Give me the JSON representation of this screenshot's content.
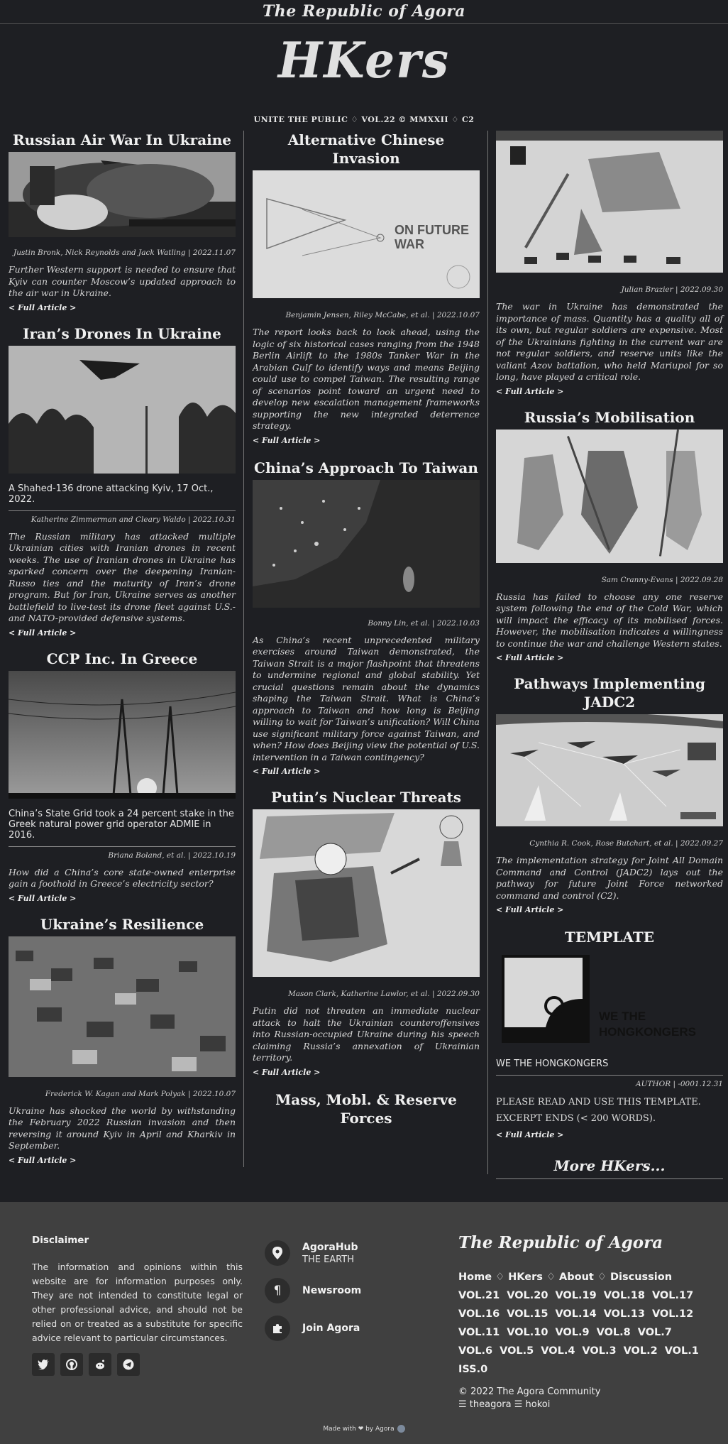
{
  "header": {
    "site_title": "The Republic of Agora",
    "logo": "HKers",
    "subline": "UNITE THE PUBLIC ♢ VOL.22 © MMXXII ♢ C2"
  },
  "articles": {
    "air_war": {
      "title": "Russian Air War In Ukraine",
      "byline": "Justin Bronk, Nick Reynolds and Jack Watling | 2022.11.07",
      "excerpt": "Further Western support is needed to ensure that Kyiv can counter Moscow’s updated approach to the air war in Ukraine.",
      "full": "< Full Article >"
    },
    "drones": {
      "title": "Iran’s Drones In Ukraine",
      "caption": "A Shahed-136 drone attacking Kyiv, 17 Oct., 2022.",
      "byline": "Katherine Zimmerman and Cleary Waldo | 2022.10.31",
      "excerpt": "The Russian military has attacked multiple Ukrainian cities with Iranian drones in recent weeks. The use of Iranian drones in Ukraine has sparked concern over the deepening Iranian-Russo ties and the maturity of Iran’s drone program. But for Iran, Ukraine serves as another battlefield to live-test its drone fleet against U.S.- and NATO-provided defensive systems.",
      "full": "< Full Article >"
    },
    "greece": {
      "title": "CCP Inc. In Greece",
      "caption": "China’s State Grid took a 24 percent stake in the Greek natural power grid operator ADMIE in 2016.",
      "byline": "Briana Boland, et al. | 2022.10.19",
      "excerpt": "How did a China’s core state-owned enterprise gain a foothold in Greece’s electricity sector?",
      "full": "< Full Article >"
    },
    "resilience": {
      "title": "Ukraine’s Resilience",
      "byline": "Frederick W. Kagan and Mark Polyak | 2022.10.07",
      "excerpt": "Ukraine has shocked the world by withstanding the February 2022 Russian invasion and then reversing it around Kyiv in April and Kharkiv in September.",
      "full": "< Full Article >"
    },
    "chinese_invasion": {
      "title": "Alternative Chinese Invasion",
      "image_text_1": "ON FUTURE",
      "image_text_2": "WAR",
      "byline": "Benjamin Jensen, Riley McCabe, et al. | 2022.10.07",
      "excerpt": "The report looks back to look ahead, using the logic of six historical cases ranging from the 1948 Berlin Airlift to the 1980s Tanker War in the Arabian Gulf to identify ways and means Beijing could use to compel Taiwan. The resulting range of scenarios point toward an urgent need to develop new escalation management frameworks supporting the new integrated deterrence strategy.",
      "full": "< Full Article >"
    },
    "taiwan": {
      "title": "China’s Approach To Taiwan",
      "byline": "Bonny Lin, et al. | 2022.10.03",
      "excerpt": "As China’s recent unprecedented military exercises around Taiwan demonstrated, the Taiwan Strait is a major flashpoint that threatens to undermine regional and global stability. Yet crucial questions remain about the dynamics shaping the Taiwan Strait. What is China’s approach to Taiwan and how long is Beijing willing to wait for Taiwan’s unification? Will China use significant military force against Taiwan, and when? How does Beijing view the potential of U.S. intervention in a Taiwan contingency?",
      "full": "< Full Article >"
    },
    "nuclear": {
      "title": "Putin’s Nuclear Threats",
      "byline": "Mason Clark, Katherine Lawlor, et al. | 2022.09.30",
      "excerpt": "Putin did not threaten an immediate nuclear attack to halt the Ukrainian counteroffensives into Russian-occupied Ukraine during his speech claiming Russia’s annexation of Ukrainian territory.",
      "full": "< Full Article >"
    },
    "mass": {
      "title": "Mass, Mobl. & Reserve Forces"
    },
    "mass_body": {
      "byline": "Julian Brazier | 2022.09.30",
      "excerpt": "The war in Ukraine has demonstrated the importance of mass. Quantity has a quality all of its own, but regular soldiers are expensive. Most of the Ukrainians fighting in the current war are not regular soldiers, and reserve units like the valiant Azov battalion, who held Mariupol for so long, have played a critical role.",
      "full": "< Full Article >"
    },
    "mobilisation": {
      "title": "Russia’s Mobilisation",
      "byline": "Sam Cranny-Evans | 2022.09.28",
      "excerpt": "Russia has failed to choose any one reserve system following the end of the Cold War, which will impact the efficacy of its mobilised forces. However, the mobilisation indicates a willingness to continue the war and challenge Western states.",
      "full": "< Full Article >"
    },
    "jadc2": {
      "title": "Pathways Implementing JADC2",
      "byline": "Cynthia R. Cook, Rose Butchart, et al. | 2022.09.27",
      "excerpt": "The implementation strategy for Joint All Domain Command and Control (JADC2) lays out the pathway for future Joint Force networked command and control (C2).",
      "full": "< Full Article >"
    },
    "template": {
      "title": "TEMPLATE",
      "image_text_1": "WE THE",
      "image_text_2": "HONGKONGERS",
      "caption": "WE THE HONGKONGERS",
      "byline": "AUTHOR | -0001.12.31",
      "excerpt_1": "PLEASE READ AND USE THIS TEMPLATE.",
      "excerpt_2": "EXCERPT ENDS (< 200 WORDS).",
      "full": "< Full Article >"
    }
  },
  "more_link": "More HKers...",
  "footer": {
    "disclaimer_title": "Disclaimer",
    "disclaimer_text": "The information and opinions within this website are for information purposes only. They are not intended to constitute legal or other professional advice, and should not be relied on or treated as a substitute for specific advice relevant to particular circumstances.",
    "links": [
      {
        "title": "AgoraHub",
        "sub": "THE EARTH",
        "icon": "location-icon"
      },
      {
        "title": "Newsroom",
        "sub": "",
        "icon": "pilcrow-icon"
      },
      {
        "title": "Join Agora",
        "sub": "",
        "icon": "puzzle-icon"
      }
    ],
    "brand": "The Republic of Agora",
    "nav": [
      "Home",
      "HKers",
      "About",
      "Discussion"
    ],
    "nav_sep": "♢",
    "vols": [
      "VOL.21",
      "VOL.20",
      "VOL.19",
      "VOL.18",
      "VOL.17",
      "VOL.16",
      "VOL.15",
      "VOL.14",
      "VOL.13",
      "VOL.12",
      "VOL.11",
      "VOL.10",
      "VOL.9",
      "VOL.8",
      "VOL.7",
      "VOL.6",
      "VOL.5",
      "VOL.4",
      "VOL.3",
      "VOL.2",
      "VOL.1",
      "ISS.0"
    ],
    "copyright": "© 2022 The Agora Community",
    "handles": "☰ theagora ☰ hokoi",
    "made_with": "Made with ❤ by Agora",
    "socials": [
      "twitter-icon",
      "github-icon",
      "reddit-icon",
      "telegram-icon"
    ]
  }
}
